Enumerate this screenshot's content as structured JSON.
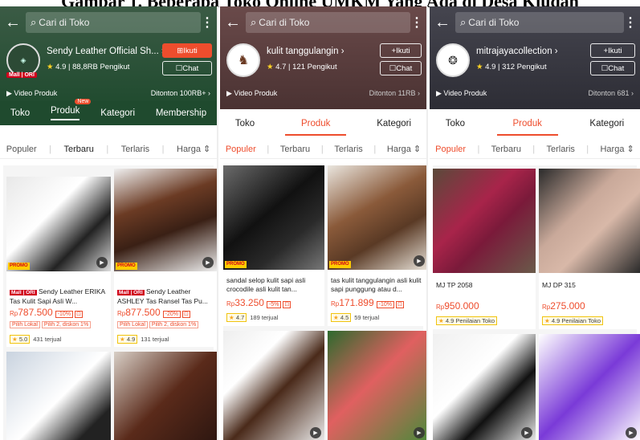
{
  "caption": "Gambar 1. Beberapa Toko Online UMKM Yang Ada di Desa Kludan",
  "panels": [
    {
      "search_placeholder": "Cari di Toko",
      "shop_name": "Sendy Leather Official Sh...",
      "rating": "4.9",
      "followers": "88,8RB Pengikut",
      "follow_label": "Ikuti",
      "chat_label": "Chat",
      "video_label": "Video Produk",
      "views": "Ditonton 100RB+",
      "tabs": [
        "Toko",
        "Produk",
        "Kategori",
        "Membership"
      ],
      "tab_badge": "New",
      "sort": [
        "Populer",
        "Terbaru",
        "Terlaris",
        "Harga"
      ],
      "products": [
        {
          "title": "Sendy Leather ERIKA Tas Kulit Sapi Asli W...",
          "price": "787.500",
          "discount": "-10%",
          "chips": [
            "Pilih Lokal",
            "Pilih 2, diskon 1%"
          ],
          "rating": "5.0",
          "sold": "431 terjual",
          "mall": "Mall | ORI"
        },
        {
          "title": "Sendy Leather ASHLEY Tas Ransel Tas Pu...",
          "price": "877.500",
          "discount": "-20%",
          "chips": [
            "Pilih Lokal",
            "Pilih 2, diskon 1%"
          ],
          "rating": "4.9",
          "sold": "131 terjual",
          "mall": "Mall | ORI"
        }
      ]
    },
    {
      "search_placeholder": "Cari di Toko",
      "shop_name": "kulit tanggulangin",
      "rating": "4.7",
      "followers": "121 Pengikut",
      "follow_label": "Ikuti",
      "chat_label": "Chat",
      "video_label": "Video Produk",
      "views": "Ditonton 11RB",
      "tabs": [
        "Toko",
        "Produk",
        "Kategori"
      ],
      "sort": [
        "Populer",
        "Terbaru",
        "Terlaris",
        "Harga"
      ],
      "products": [
        {
          "title": "sandal selop kulit sapi asli crocodile asli kulit tan...",
          "price": "33.250",
          "discount": "-5%",
          "rating": "4.7",
          "sold": "189 terjual"
        },
        {
          "title": "tas kulit tanggulangin asli kulit sapi punggung atau d...",
          "price": "171.899",
          "discount": "-10%",
          "rating": "4.5",
          "sold": "59 terjual"
        }
      ]
    },
    {
      "search_placeholder": "Cari di Toko",
      "shop_name": "mitrajayacollection",
      "rating": "4.9",
      "followers": "312 Pengikut",
      "follow_label": "Ikuti",
      "chat_label": "Chat",
      "video_label": "Video Produk",
      "views": "Ditonton 681",
      "tabs": [
        "Toko",
        "Produk",
        "Kategori"
      ],
      "sort": [
        "Populer",
        "Terbaru",
        "Terlaris",
        "Harga"
      ],
      "products": [
        {
          "title": "MJ TP 2058",
          "price": "950.000",
          "badge": "4.9 Penilaian Toko"
        },
        {
          "title": "MJ DP 315",
          "price": "275.000",
          "badge": "4.9 Penilaian Toko"
        }
      ]
    }
  ],
  "promo_label": "PROMO",
  "currency": "Rp",
  "colors": {
    "accent": "#ee4d2d",
    "panel1_header": "#1f4a2e",
    "panel2_header": "#5a3c3a",
    "panel3_header": "#3a3a44"
  }
}
